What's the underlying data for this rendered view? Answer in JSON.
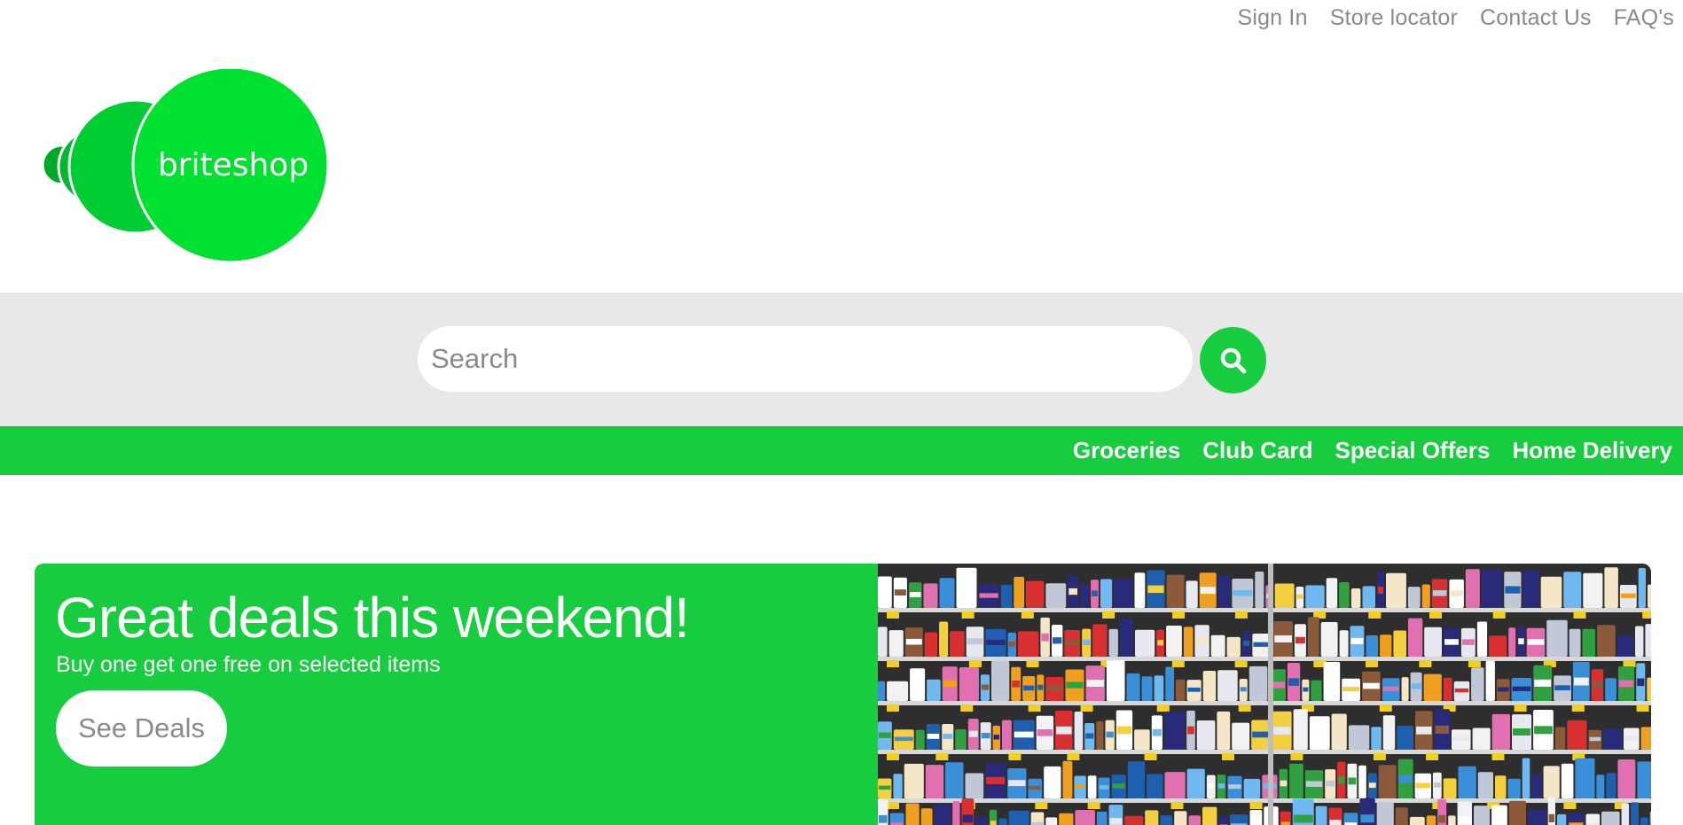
{
  "top_links": [
    "Sign In",
    "Store locator",
    "Contact Us",
    "FAQ's"
  ],
  "logo": {
    "text": "briteshop"
  },
  "search": {
    "placeholder": "Search"
  },
  "nav": {
    "items": [
      "Groceries",
      "Club Card",
      "Special Offers",
      "Home Delivery"
    ]
  },
  "hero": {
    "title": "Great deals this weekend!",
    "subtitle": "Buy one get one free on selected items",
    "button_label": "See Deals"
  },
  "colors": {
    "brand_green": "#18cc3f",
    "logo_green": "#00e030",
    "band_gray": "#e8e8e8",
    "muted_text": "#8a8a8a"
  }
}
